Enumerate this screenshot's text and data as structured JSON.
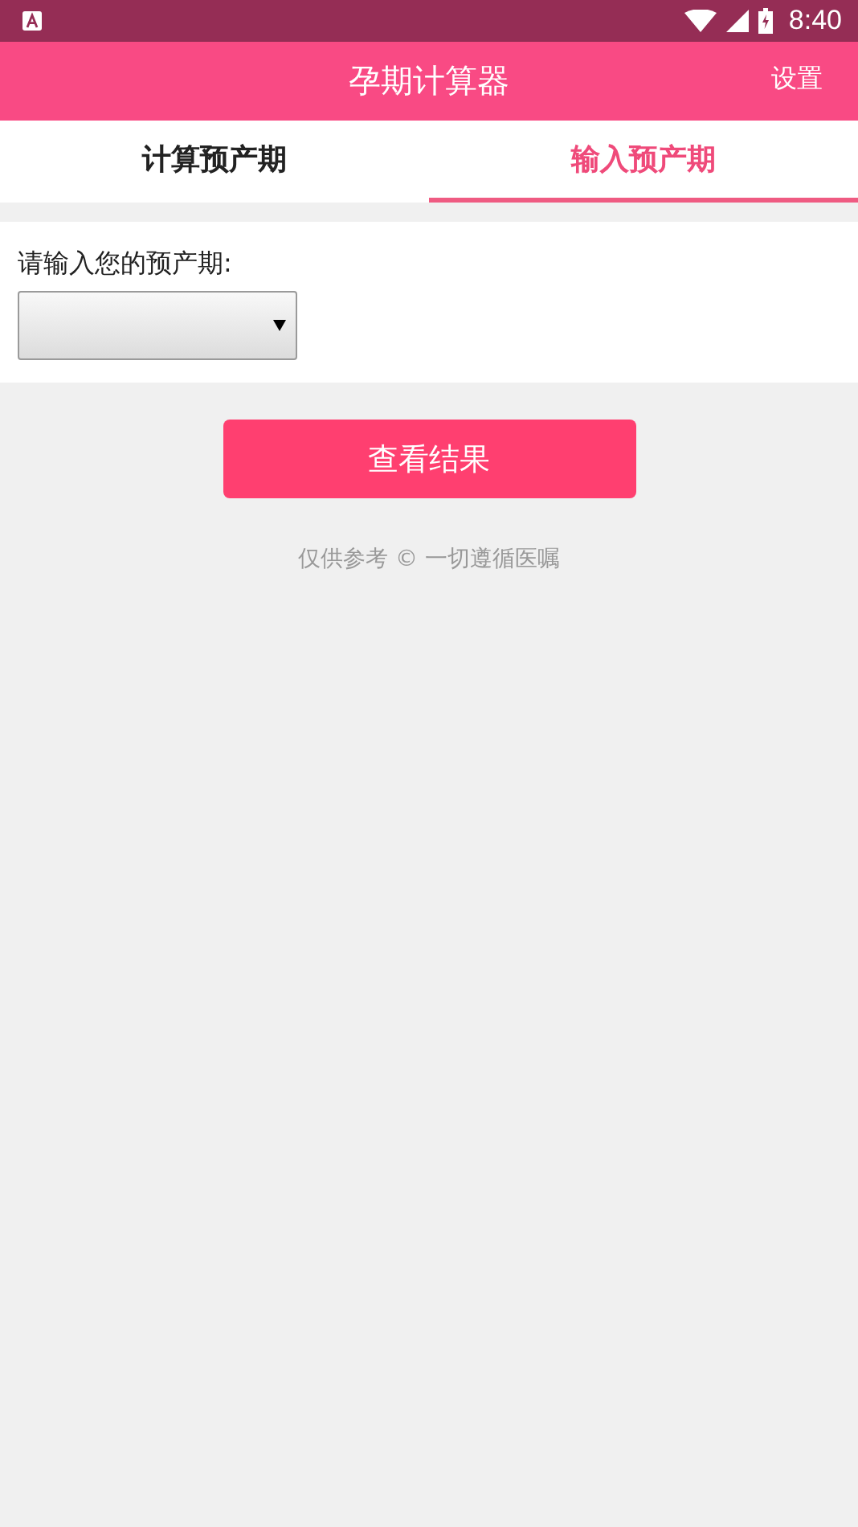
{
  "status_bar": {
    "time": "8:40"
  },
  "app_bar": {
    "title": "孕期计算器",
    "action": "设置"
  },
  "tabs": [
    {
      "label": "计算预产期",
      "selected": false
    },
    {
      "label": "输入预产期",
      "selected": true
    }
  ],
  "form": {
    "label": "请输入您的预产期:"
  },
  "submit_button": "查看结果",
  "footer": "仅供参考 © 一切遵循医嘱"
}
